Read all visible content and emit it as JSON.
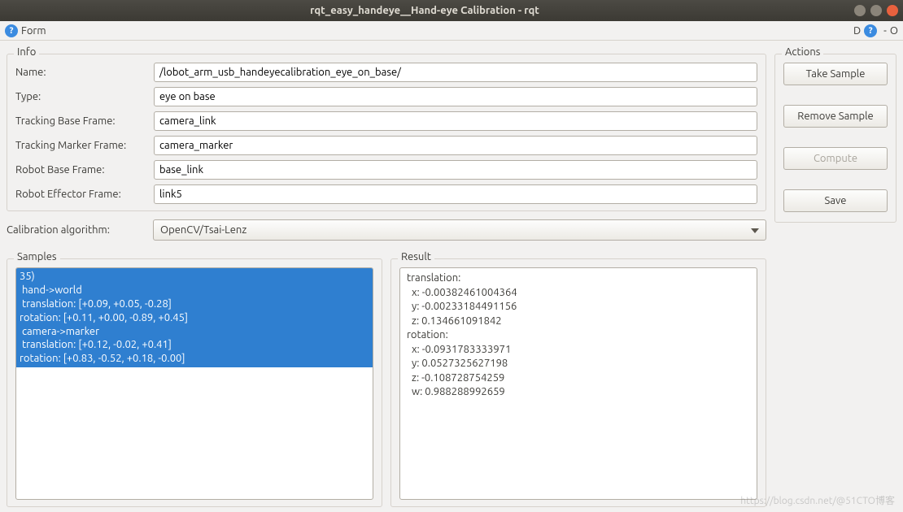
{
  "window": {
    "title": "rqt_easy_handeye__Hand-eye Calibration - rqt"
  },
  "toolbar": {
    "form_label": "Form",
    "d_label": "D",
    "dash": "-",
    "o": "O"
  },
  "info": {
    "legend": "Info",
    "rows": {
      "name": {
        "label": "Name:",
        "value": "/lobot_arm_usb_handeyecalibration_eye_on_base/"
      },
      "type": {
        "label": "Type:",
        "value": "eye on base"
      },
      "tracking_base": {
        "label": "Tracking Base Frame:",
        "value": "camera_link"
      },
      "tracking_marker": {
        "label": "Tracking Marker Frame:",
        "value": "camera_marker"
      },
      "robot_base": {
        "label": "Robot Base Frame:",
        "value": "base_link"
      },
      "robot_effector": {
        "label": "Robot Effector Frame:",
        "value": "link5"
      }
    }
  },
  "algorithm": {
    "label": "Calibration algorithm:",
    "value": "OpenCV/Tsai-Lenz"
  },
  "samples": {
    "legend": "Samples",
    "visible_item": "35)\n hand->world\n translation: [+0.09, +0.05, -0.28]\nrotation: [+0.11, +0.00, -0.89, +0.45]\n camera->marker\n translation: [+0.12, -0.02, +0.41]\nrotation: [+0.83, -0.52, +0.18, -0.00]"
  },
  "result": {
    "legend": "Result",
    "text": "translation:\n  x: -0.00382461004364\n  y: -0.00233184491156\n  z: 0.134661091842\nrotation:\n  x: -0.0931783333971\n  y: 0.0527325627198\n  z: -0.108728754259\n  w: 0.988288992659"
  },
  "actions": {
    "legend": "Actions",
    "take_sample": "Take Sample",
    "remove_sample": "Remove Sample",
    "compute": "Compute",
    "save": "Save"
  },
  "watermark": "https://blog.csdn.net/@51CTO博客"
}
